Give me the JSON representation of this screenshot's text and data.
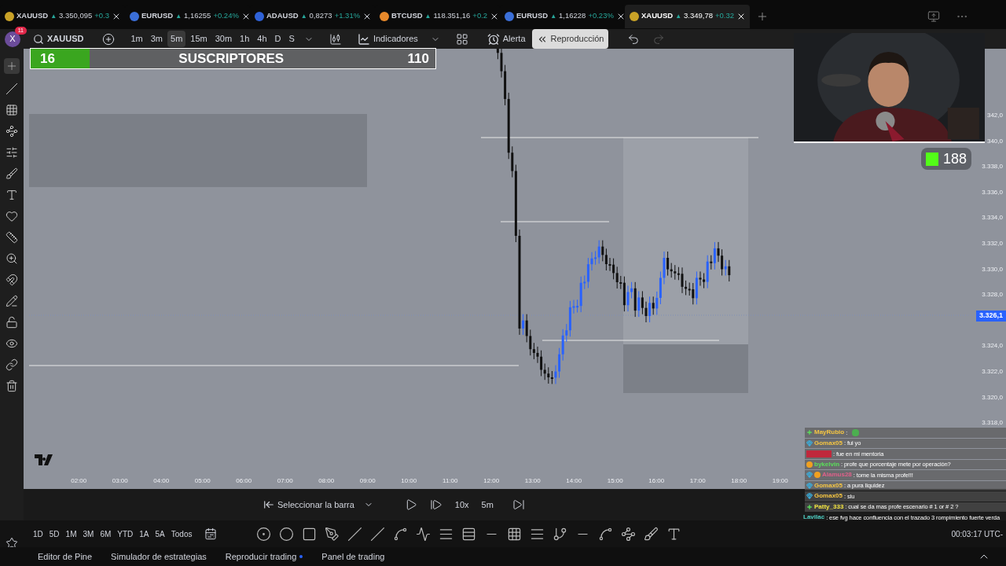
{
  "tabs": [
    {
      "symbol": "XAUUSD",
      "arrow": "▲",
      "price": "3.350,095",
      "change": "+0.3",
      "color": "#c9a227",
      "selected": false
    },
    {
      "symbol": "EURUSD",
      "arrow": "▲",
      "price": "1,16255",
      "change": "+0.24%",
      "color": "#3b6fd8",
      "selected": false
    },
    {
      "symbol": "ADAUSD",
      "arrow": "▲",
      "price": "0,8273",
      "change": "+1.31%",
      "color": "#2f62d8",
      "selected": false
    },
    {
      "symbol": "BTCUSD",
      "arrow": "▲",
      "price": "118.351,16",
      "change": "+0.2",
      "color": "#e8892b",
      "selected": false
    },
    {
      "symbol": "EURUSD",
      "arrow": "▲",
      "price": "1,16228",
      "change": "+0.23%",
      "color": "#3b6fd8",
      "selected": false
    },
    {
      "symbol": "XAUUSD",
      "arrow": "▲",
      "price": "3.349,78",
      "change": "+0.32",
      "color": "#c9a227",
      "selected": true
    }
  ],
  "toolbar": {
    "avatar": "X",
    "notifications": "11",
    "symbol": "XAUUSD",
    "intervals": [
      {
        "label": "1m",
        "selected": false
      },
      {
        "label": "3m",
        "selected": false
      },
      {
        "label": "5m",
        "selected": true
      },
      {
        "label": "15m",
        "selected": false
      },
      {
        "label": "30m",
        "selected": false
      },
      {
        "label": "1h",
        "selected": false
      },
      {
        "label": "4h",
        "selected": false
      },
      {
        "label": "D",
        "selected": false
      },
      {
        "label": "S",
        "selected": false
      }
    ],
    "indicators": "Indicadores",
    "alert": "Alerta",
    "replay": {
      "label": "Reproducción",
      "selected": true
    }
  },
  "subscriber_goal": {
    "current": "16",
    "label": "SUSCRIPTORES",
    "goal": "110",
    "level": 0.145
  },
  "viewer_count": "188",
  "chart": {
    "price_labels_partial": [
      "342,0",
      "340,0"
    ],
    "price_labels_upper": [
      "3.338,0",
      "3.336,0",
      "3.334,0",
      "3.332,0",
      "3.330,0",
      "3.328,0"
    ],
    "current_price": "3.326,1",
    "price_labels_lower": [
      "3.324,0",
      "3.322,0",
      "3.320,0",
      "3.318,0"
    ],
    "time_labels": [
      "02:00",
      "03:00",
      "04:00",
      "05:00",
      "06:00",
      "07:00",
      "08:00",
      "09:00",
      "10:00",
      "11:00",
      "12:00",
      "13:00",
      "14:00",
      "15:00",
      "16:00",
      "17:00",
      "18:00",
      "19:00"
    ]
  },
  "chat": [
    {
      "kind": "named",
      "name": "MayRubio",
      "text": ":",
      "color": "#f5c542",
      "badges": [
        {
          "kind": "plus"
        }
      ],
      "emote": true
    },
    {
      "kind": "named",
      "name": "Gomax05",
      "text": ": fui yo",
      "color": "#f5c542",
      "badges": [
        {
          "kind": "gem"
        }
      ],
      "emote": false
    },
    {
      "kind": "masked",
      "text": ": fue en mi mentoria",
      "color": "#c0283c",
      "emote": false
    },
    {
      "kind": "named",
      "name": "bykelvin",
      "text": ": profe que porcentaje mete por operación?",
      "color": "#5be05b",
      "badges": [
        {
          "kind": "coin"
        }
      ],
      "emote": false
    },
    {
      "kind": "named",
      "name": "Alamus28",
      "text": ": tome la misma profe!!!",
      "color": "#e0608a",
      "badges": [
        {
          "kind": "gem"
        },
        {
          "kind": "coin"
        }
      ],
      "emote": false
    },
    {
      "kind": "named",
      "name": "Gomax05",
      "text": ": a pura liquidez",
      "color": "#f5c542",
      "badges": [
        {
          "kind": "gem"
        }
      ],
      "emote": false
    },
    {
      "kind": "named",
      "name": "Gomax05",
      "text": ": slu",
      "color": "#f5c542",
      "badges": [
        {
          "kind": "gem"
        }
      ],
      "emote": false
    },
    {
      "kind": "named",
      "name": "Patty_333",
      "text": ": cual se da mas profe escenario # 1 or # 2 ?",
      "color": "#f5e642",
      "badges": [
        {
          "kind": "plus"
        }
      ],
      "emote": false
    },
    {
      "kind": "plain",
      "name": "Lavilac",
      "text": ": ese fvg hace confluencia con el trazado 3 rompimiento fuerte verda",
      "color": "#4fd1c5"
    }
  ],
  "replay_bar": {
    "select_bar": "Seleccionar la barra",
    "speed": "10x",
    "interval": "5m"
  },
  "ranges": [
    "1D",
    "5D",
    "1M",
    "3M",
    "6M",
    "YTD",
    "1A",
    "5A",
    "Todos"
  ],
  "clock": "00:03:17 UTC-",
  "bottom_tabs": [
    {
      "label": "Editor de Pine",
      "dot": false
    },
    {
      "label": "Simulador de estrategias",
      "dot": false
    },
    {
      "label": "Reproducir trading",
      "dot": true
    },
    {
      "label": "Panel de trading",
      "dot": false
    }
  ]
}
